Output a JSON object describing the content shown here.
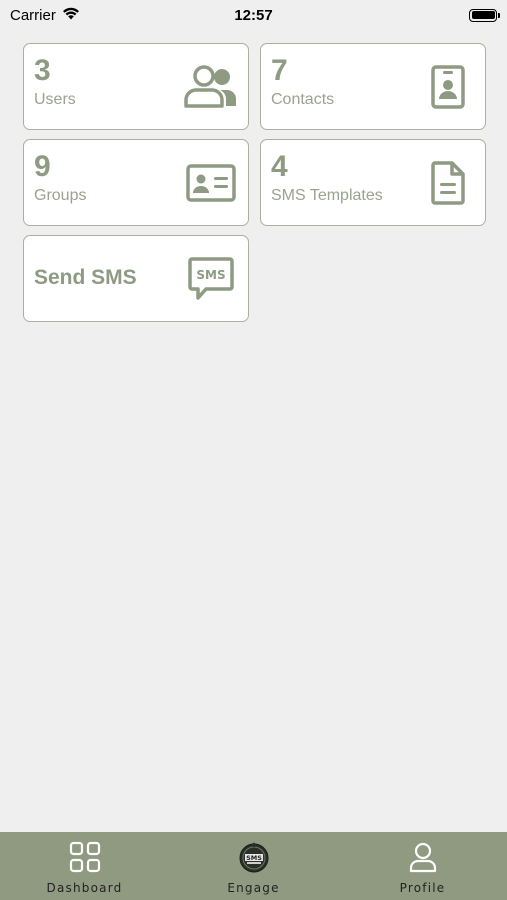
{
  "status_bar": {
    "carrier": "Carrier",
    "time": "12:57"
  },
  "cards": [
    {
      "count": "3",
      "label": "Users",
      "icon": "users-icon"
    },
    {
      "count": "7",
      "label": "Contacts",
      "icon": "contact-badge-icon"
    },
    {
      "count": "9",
      "label": "Groups",
      "icon": "id-card-icon"
    },
    {
      "count": "4",
      "label": "SMS Templates",
      "icon": "document-icon"
    },
    {
      "title": "Send SMS",
      "icon": "sms-bubble-icon"
    }
  ],
  "tab_bar": {
    "tabs": [
      {
        "label": "Dashboard",
        "icon": "grid-icon"
      },
      {
        "label": "Engage",
        "icon": "sms-logo-icon"
      },
      {
        "label": "Profile",
        "icon": "person-icon"
      }
    ]
  },
  "colors": {
    "accent": "#8e9a82",
    "tab_bar_bg": "#909a80",
    "page_bg": "#efefef"
  }
}
